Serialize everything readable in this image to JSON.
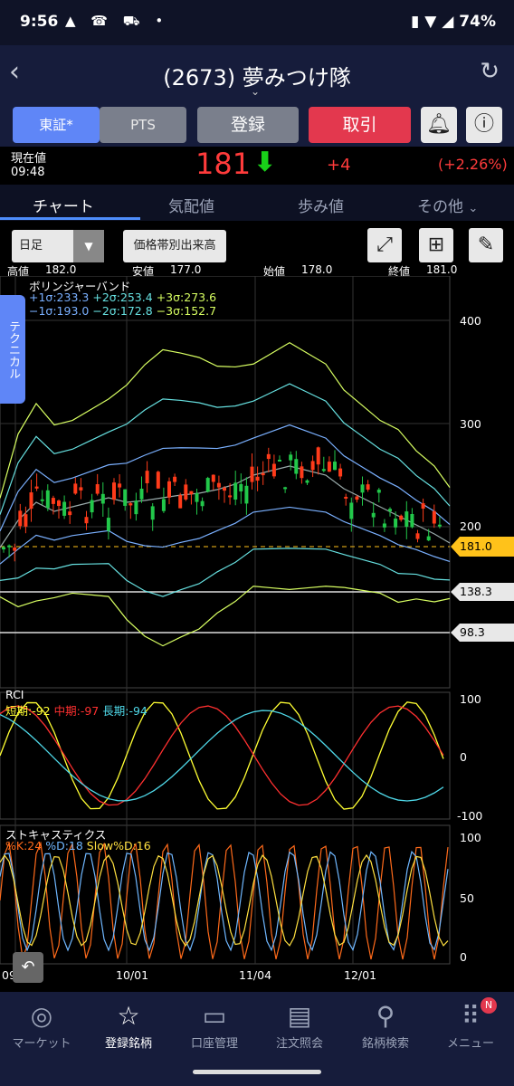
{
  "status": {
    "time": "9:56",
    "icons_left": "▲ ☎ ⛟ •",
    "battery": "74%"
  },
  "header": {
    "title": "(2673) 夢みつけ隊"
  },
  "toolbar": {
    "market_tse": "東証*",
    "market_pts": "PTS",
    "register": "登録",
    "trade": "取引"
  },
  "quote": {
    "label": "現在値",
    "time": "09:48",
    "price": "181",
    "change": "+4",
    "change_pct": "(+2.26%)",
    "colors": {
      "up": "#ff3b3b",
      "down_arrow": "#19d119"
    }
  },
  "tabs": [
    "チャート",
    "気配値",
    "歩み値",
    "その他"
  ],
  "controls": {
    "period": "日足",
    "volume_by_price": "価格帯別出来高"
  },
  "ohlc": {
    "high_label": "高値",
    "high": "182.0",
    "low_label": "安値",
    "low": "177.0",
    "open_label": "始値",
    "open": "178.0",
    "close_label": "終値",
    "close": "181.0"
  },
  "technical_tab": "テクニカル",
  "bollinger": {
    "title": "ボリンジャーバンド",
    "row1": [
      {
        "t": "+1σ:233.3",
        "c": "#7ab0ff"
      },
      {
        "t": "+2σ:253.4",
        "c": "#66e0e0"
      },
      {
        "t": "+3σ:273.6",
        "c": "#d8ff62"
      }
    ],
    "row2": [
      {
        "t": "−1σ:193.0",
        "c": "#7ab0ff"
      },
      {
        "t": "−2σ:172.8",
        "c": "#66e0e0"
      },
      {
        "t": "−3σ:152.7",
        "c": "#d8ff62"
      }
    ],
    "y_ticks": [
      "400",
      "300",
      "200"
    ],
    "price_tag": "181.0",
    "level_tags": [
      "138.3",
      "98.3"
    ]
  },
  "rci": {
    "title": "RCI",
    "short": "短期:-92",
    "mid": "中期:-97",
    "long": "長期:-94",
    "y_ticks": [
      "100",
      "0",
      "-100"
    ]
  },
  "stoch": {
    "title": "ストキャスティクス",
    "k": "%K:24",
    "d": "%D:18",
    "slow": "Slow%D:16",
    "y_ticks": [
      "100",
      "50",
      "0"
    ]
  },
  "x_ticks": [
    "09",
    "10/01",
    "11/04",
    "12/01"
  ],
  "nav": [
    {
      "label": "マーケット",
      "icon": "globe-icon"
    },
    {
      "label": "登録銘柄",
      "icon": "star-icon"
    },
    {
      "label": "口座管理",
      "icon": "card-icon"
    },
    {
      "label": "注文照会",
      "icon": "document-icon"
    },
    {
      "label": "銘柄検索",
      "icon": "search-icon"
    },
    {
      "label": "メニュー",
      "icon": "grid-icon"
    }
  ],
  "menu_badge": "N"
}
